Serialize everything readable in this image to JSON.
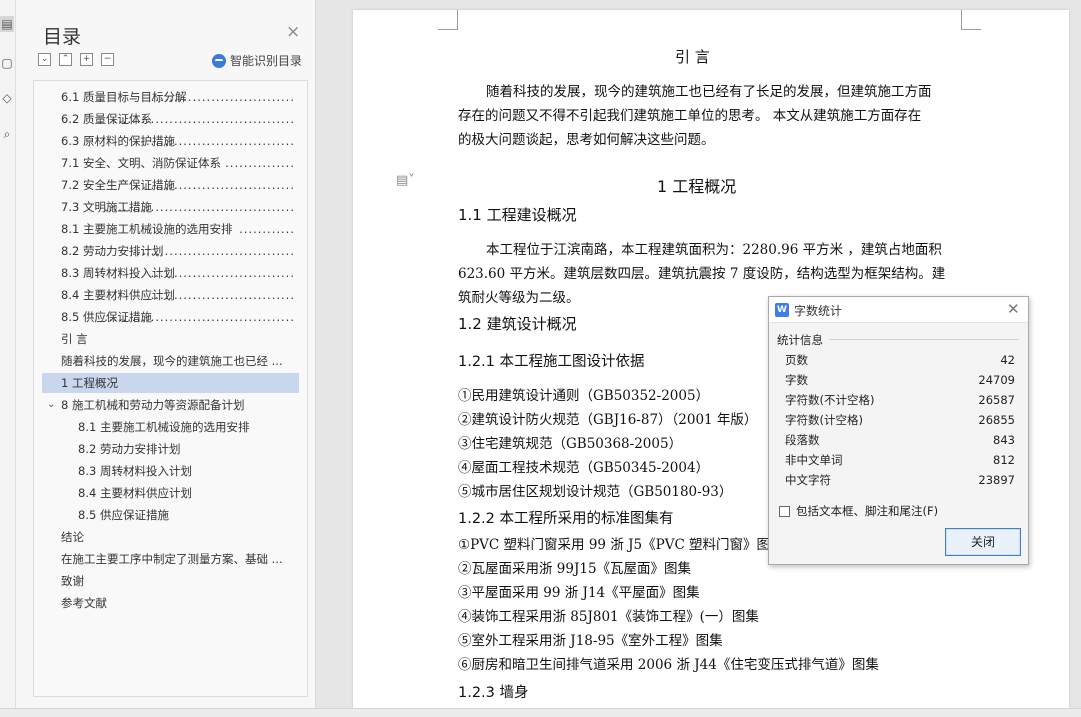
{
  "rail": {
    "icons": [
      "outline-icon",
      "thumbnail-icon",
      "bookmark-icon",
      "search-icon"
    ]
  },
  "toc": {
    "title": "目录",
    "close_glyph": "×",
    "tools": [
      "⌄",
      "⌃",
      "+",
      "−"
    ],
    "smart_label": "智能识别目录",
    "items": [
      {
        "label": "6.1  质量目标与目标分解",
        "dots": "...............................",
        "level": 1
      },
      {
        "label": "6.2  质量保证体系",
        "dots": ".......................................",
        "level": 1
      },
      {
        "label": "6.3  原材料的保护措施",
        "dots": ".................................",
        "level": 1
      },
      {
        "label": "7.1  安全、文明、消防保证体系",
        "dots": "...............",
        "level": 1
      },
      {
        "label": "7.2  安全生产保证措施",
        "dots": "...............................",
        "level": 1
      },
      {
        "label": "7.3  文明施工措施",
        "dots": ".........................................",
        "level": 1
      },
      {
        "label": "8.1  主要施工机械设施的选用安排",
        "dots": "............",
        "level": 1
      },
      {
        "label": "8.2  劳动力安排计划",
        "dots": "...................................",
        "level": 1
      },
      {
        "label": "8.3  周转材料投入计划",
        "dots": "...............................",
        "level": 1
      },
      {
        "label": "8.4  主要材料供应计划",
        "dots": "...............................",
        "level": 1
      },
      {
        "label": "8.5  供应保证措施",
        "dots": ".........................................",
        "level": 1
      },
      {
        "label": "引        言",
        "dots": "",
        "level": 1
      },
      {
        "label": "随着科技的发展，现今的建筑施工也已经 ...",
        "dots": "",
        "level": 1
      },
      {
        "label": "1   工程概况",
        "dots": "",
        "level": 1,
        "selected": true
      },
      {
        "label": "8 施工机械和劳动力等资源配备计划",
        "dots": "",
        "level": 1,
        "expanded": true
      },
      {
        "label": "8.1 主要施工机械设施的选用安排",
        "dots": "",
        "level": 2
      },
      {
        "label": "8.2 劳动力安排计划",
        "dots": "",
        "level": 2
      },
      {
        "label": "8.3 周转材料投入计划",
        "dots": "",
        "level": 2
      },
      {
        "label": "8.4    主要材料供应计划",
        "dots": "",
        "level": 2
      },
      {
        "label": "8.5 供应保证措施",
        "dots": "",
        "level": 2
      },
      {
        "label": "结论",
        "dots": "",
        "level": 1
      },
      {
        "label": "在施工主要工序中制定了测量方案、基础 ...",
        "dots": "",
        "level": 1
      },
      {
        "label": "致谢",
        "dots": "",
        "level": 1
      },
      {
        "label": "参考文献",
        "dots": "",
        "level": 1
      }
    ]
  },
  "document": {
    "intro_title": "引        言",
    "intro_p1": "随着科技的发展，现今的建筑施工也已经有了长足的发展，但建筑施工方面",
    "intro_p2": "存在的问题又不得不引起我们建筑施工单位的思考。 本文从建筑施工方面存在",
    "intro_p3": "的极大问题谈起，思考如何解决这些问题。",
    "ch1_title": "1    工程概况",
    "s11": "1.1  工程建设概况",
    "s11_p1": "本工程位于江滨南路，本工程建筑面积为：2280.96 平方米 ，建筑占地面积",
    "s11_p2": "623.60 平方米。建筑层数四层。建筑抗震按 7 度设防，结构选型为框架结构。建",
    "s11_p3": "筑耐火等级为二级。",
    "s12": "1.2  建筑设计概况",
    "s121": "1.2.1  本工程施工图设计依据",
    "codes": [
      "①民用建筑设计通则（GB50352-2005）",
      "②建筑设计防火规范（GBJ16-87）（2001 年版）",
      "③住宅建筑规范（GB50368-2005）",
      "④屋面工程技术规范（GB50345-2004）",
      "⑤城市居住区规划设计规范（GB50180-93）"
    ],
    "s122": "1.2.2 本工程所采用的标准图集有",
    "atlases": [
      "①PVC 塑料门窗采用 99 浙 J5《PVC 塑料门窗》图集",
      "②瓦屋面采用浙 99J15《瓦屋面》图集",
      "③平屋面采用 99 浙 J14《平屋面》图集",
      "④装饰工程采用浙 85J801《装饰工程》(一）图集",
      "⑤室外工程采用浙 J18-95《室外工程》图集",
      "⑥厨房和暗卫生间排气道采用 2006 浙 J44《住宅变压式排气道》图集"
    ],
    "s123": "1.2.3 墙身"
  },
  "dialog": {
    "logo": "W",
    "title": "字数统计",
    "section": "统计信息",
    "stats": [
      {
        "k": "页数",
        "v": "42"
      },
      {
        "k": "字数",
        "v": "24709"
      },
      {
        "k": "字符数(不计空格)",
        "v": "26587"
      },
      {
        "k": "字符数(计空格)",
        "v": "26855"
      },
      {
        "k": "段落数",
        "v": "843"
      },
      {
        "k": "非中文单词",
        "v": "812"
      },
      {
        "k": "中文字符",
        "v": "23897"
      }
    ],
    "checkbox_label": "包括文本框、脚注和尾注(F)",
    "close_button": "关闭"
  }
}
